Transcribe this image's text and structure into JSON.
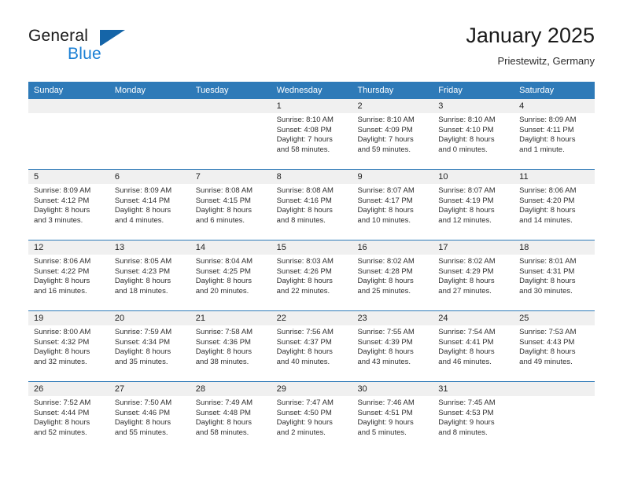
{
  "brand": {
    "word1": "General",
    "word2": "Blue",
    "triangle_color": "#1565a8",
    "blue_color": "#1a7fd4"
  },
  "header": {
    "month_title": "January 2025",
    "location": "Priestewitz, Germany"
  },
  "theme": {
    "header_blue": "#2e7ab8",
    "daterow_gray": "#f0f0f0",
    "body_white": "#ffffff",
    "text": "#2f2f2f"
  },
  "calendar": {
    "weekday_headers": [
      "Sunday",
      "Monday",
      "Tuesday",
      "Wednesday",
      "Thursday",
      "Friday",
      "Saturday"
    ],
    "weeks": [
      {
        "days": [
          {
            "num": "",
            "lines": [
              "",
              "",
              "",
              ""
            ]
          },
          {
            "num": "",
            "lines": [
              "",
              "",
              "",
              ""
            ]
          },
          {
            "num": "",
            "lines": [
              "",
              "",
              "",
              ""
            ]
          },
          {
            "num": "1",
            "lines": [
              "Sunrise: 8:10 AM",
              "Sunset: 4:08 PM",
              "Daylight: 7 hours",
              "and 58 minutes."
            ]
          },
          {
            "num": "2",
            "lines": [
              "Sunrise: 8:10 AM",
              "Sunset: 4:09 PM",
              "Daylight: 7 hours",
              "and 59 minutes."
            ]
          },
          {
            "num": "3",
            "lines": [
              "Sunrise: 8:10 AM",
              "Sunset: 4:10 PM",
              "Daylight: 8 hours",
              "and 0 minutes."
            ]
          },
          {
            "num": "4",
            "lines": [
              "Sunrise: 8:09 AM",
              "Sunset: 4:11 PM",
              "Daylight: 8 hours",
              "and 1 minute."
            ]
          }
        ]
      },
      {
        "days": [
          {
            "num": "5",
            "lines": [
              "Sunrise: 8:09 AM",
              "Sunset: 4:12 PM",
              "Daylight: 8 hours",
              "and 3 minutes."
            ]
          },
          {
            "num": "6",
            "lines": [
              "Sunrise: 8:09 AM",
              "Sunset: 4:14 PM",
              "Daylight: 8 hours",
              "and 4 minutes."
            ]
          },
          {
            "num": "7",
            "lines": [
              "Sunrise: 8:08 AM",
              "Sunset: 4:15 PM",
              "Daylight: 8 hours",
              "and 6 minutes."
            ]
          },
          {
            "num": "8",
            "lines": [
              "Sunrise: 8:08 AM",
              "Sunset: 4:16 PM",
              "Daylight: 8 hours",
              "and 8 minutes."
            ]
          },
          {
            "num": "9",
            "lines": [
              "Sunrise: 8:07 AM",
              "Sunset: 4:17 PM",
              "Daylight: 8 hours",
              "and 10 minutes."
            ]
          },
          {
            "num": "10",
            "lines": [
              "Sunrise: 8:07 AM",
              "Sunset: 4:19 PM",
              "Daylight: 8 hours",
              "and 12 minutes."
            ]
          },
          {
            "num": "11",
            "lines": [
              "Sunrise: 8:06 AM",
              "Sunset: 4:20 PM",
              "Daylight: 8 hours",
              "and 14 minutes."
            ]
          }
        ]
      },
      {
        "days": [
          {
            "num": "12",
            "lines": [
              "Sunrise: 8:06 AM",
              "Sunset: 4:22 PM",
              "Daylight: 8 hours",
              "and 16 minutes."
            ]
          },
          {
            "num": "13",
            "lines": [
              "Sunrise: 8:05 AM",
              "Sunset: 4:23 PM",
              "Daylight: 8 hours",
              "and 18 minutes."
            ]
          },
          {
            "num": "14",
            "lines": [
              "Sunrise: 8:04 AM",
              "Sunset: 4:25 PM",
              "Daylight: 8 hours",
              "and 20 minutes."
            ]
          },
          {
            "num": "15",
            "lines": [
              "Sunrise: 8:03 AM",
              "Sunset: 4:26 PM",
              "Daylight: 8 hours",
              "and 22 minutes."
            ]
          },
          {
            "num": "16",
            "lines": [
              "Sunrise: 8:02 AM",
              "Sunset: 4:28 PM",
              "Daylight: 8 hours",
              "and 25 minutes."
            ]
          },
          {
            "num": "17",
            "lines": [
              "Sunrise: 8:02 AM",
              "Sunset: 4:29 PM",
              "Daylight: 8 hours",
              "and 27 minutes."
            ]
          },
          {
            "num": "18",
            "lines": [
              "Sunrise: 8:01 AM",
              "Sunset: 4:31 PM",
              "Daylight: 8 hours",
              "and 30 minutes."
            ]
          }
        ]
      },
      {
        "days": [
          {
            "num": "19",
            "lines": [
              "Sunrise: 8:00 AM",
              "Sunset: 4:32 PM",
              "Daylight: 8 hours",
              "and 32 minutes."
            ]
          },
          {
            "num": "20",
            "lines": [
              "Sunrise: 7:59 AM",
              "Sunset: 4:34 PM",
              "Daylight: 8 hours",
              "and 35 minutes."
            ]
          },
          {
            "num": "21",
            "lines": [
              "Sunrise: 7:58 AM",
              "Sunset: 4:36 PM",
              "Daylight: 8 hours",
              "and 38 minutes."
            ]
          },
          {
            "num": "22",
            "lines": [
              "Sunrise: 7:56 AM",
              "Sunset: 4:37 PM",
              "Daylight: 8 hours",
              "and 40 minutes."
            ]
          },
          {
            "num": "23",
            "lines": [
              "Sunrise: 7:55 AM",
              "Sunset: 4:39 PM",
              "Daylight: 8 hours",
              "and 43 minutes."
            ]
          },
          {
            "num": "24",
            "lines": [
              "Sunrise: 7:54 AM",
              "Sunset: 4:41 PM",
              "Daylight: 8 hours",
              "and 46 minutes."
            ]
          },
          {
            "num": "25",
            "lines": [
              "Sunrise: 7:53 AM",
              "Sunset: 4:43 PM",
              "Daylight: 8 hours",
              "and 49 minutes."
            ]
          }
        ]
      },
      {
        "days": [
          {
            "num": "26",
            "lines": [
              "Sunrise: 7:52 AM",
              "Sunset: 4:44 PM",
              "Daylight: 8 hours",
              "and 52 minutes."
            ]
          },
          {
            "num": "27",
            "lines": [
              "Sunrise: 7:50 AM",
              "Sunset: 4:46 PM",
              "Daylight: 8 hours",
              "and 55 minutes."
            ]
          },
          {
            "num": "28",
            "lines": [
              "Sunrise: 7:49 AM",
              "Sunset: 4:48 PM",
              "Daylight: 8 hours",
              "and 58 minutes."
            ]
          },
          {
            "num": "29",
            "lines": [
              "Sunrise: 7:47 AM",
              "Sunset: 4:50 PM",
              "Daylight: 9 hours",
              "and 2 minutes."
            ]
          },
          {
            "num": "30",
            "lines": [
              "Sunrise: 7:46 AM",
              "Sunset: 4:51 PM",
              "Daylight: 9 hours",
              "and 5 minutes."
            ]
          },
          {
            "num": "31",
            "lines": [
              "Sunrise: 7:45 AM",
              "Sunset: 4:53 PM",
              "Daylight: 9 hours",
              "and 8 minutes."
            ]
          },
          {
            "num": "",
            "lines": [
              "",
              "",
              "",
              ""
            ]
          }
        ]
      }
    ]
  }
}
